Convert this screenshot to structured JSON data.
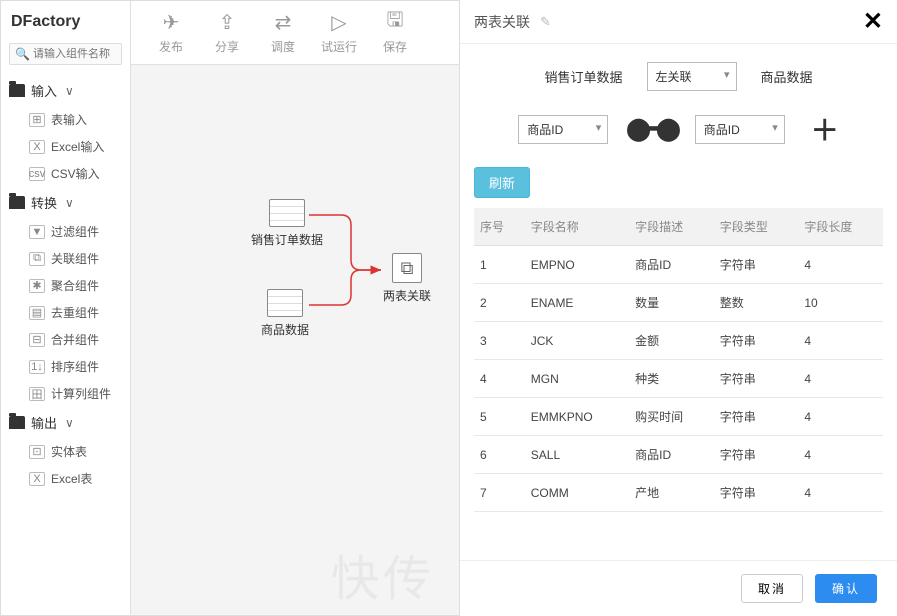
{
  "app_name": "DFactory",
  "search_placeholder": "请输入组件名称",
  "sidebar": {
    "groups": [
      {
        "label": "输入",
        "items": [
          {
            "label": "表输入",
            "icon": "⊞"
          },
          {
            "label": "Excel输入",
            "icon": "X"
          },
          {
            "label": "CSV输入",
            "icon": "csv"
          }
        ]
      },
      {
        "label": "转换",
        "items": [
          {
            "label": "过滤组件",
            "icon": "▼"
          },
          {
            "label": "关联组件",
            "icon": "⧉"
          },
          {
            "label": "聚合组件",
            "icon": "✱"
          },
          {
            "label": "去重组件",
            "icon": "▤"
          },
          {
            "label": "合并组件",
            "icon": "⊟"
          },
          {
            "label": "排序组件",
            "icon": "1↓"
          },
          {
            "label": "计算列组件",
            "icon": "田"
          }
        ]
      },
      {
        "label": "输出",
        "items": [
          {
            "label": "实体表",
            "icon": "⊡"
          },
          {
            "label": "Excel表",
            "icon": "X"
          }
        ]
      }
    ]
  },
  "toolbar": [
    {
      "label": "发布",
      "icon": "✈"
    },
    {
      "label": "分享",
      "icon": "⇪"
    },
    {
      "label": "调度",
      "icon": "⇄"
    },
    {
      "label": "试运行",
      "icon": "▷"
    },
    {
      "label": "保存",
      "icon": "🖫"
    }
  ],
  "canvas": {
    "nodes": [
      {
        "label": "销售订单数据",
        "type": "table"
      },
      {
        "label": "商品数据",
        "type": "table"
      },
      {
        "label": "两表关联",
        "type": "join"
      }
    ]
  },
  "panel": {
    "title": "两表关联",
    "left_source": "销售订单数据",
    "right_source": "商品数据",
    "join_type": "左关联",
    "left_field": "商品ID",
    "right_field": "商品ID",
    "refresh_label": "刷新",
    "headers": [
      "序号",
      "字段名称",
      "字段描述",
      "字段类型",
      "字段长度"
    ],
    "rows": [
      [
        "1",
        "EMPNO",
        "商品ID",
        "字符串",
        "4"
      ],
      [
        "2",
        "ENAME",
        "数量",
        "整数",
        "10"
      ],
      [
        "3",
        "JCK",
        "金额",
        "字符串",
        "4"
      ],
      [
        "4",
        "MGN",
        "种类",
        "字符串",
        "4"
      ],
      [
        "5",
        "EMMKPNO",
        "购买时间",
        "字符串",
        "4"
      ],
      [
        "6",
        "SALL",
        "商品ID",
        "字符串",
        "4"
      ],
      [
        "7",
        "COMM",
        "产地",
        "字符串",
        "4"
      ]
    ],
    "cancel_label": "取消",
    "confirm_label": "确认"
  },
  "watermark": "快传"
}
